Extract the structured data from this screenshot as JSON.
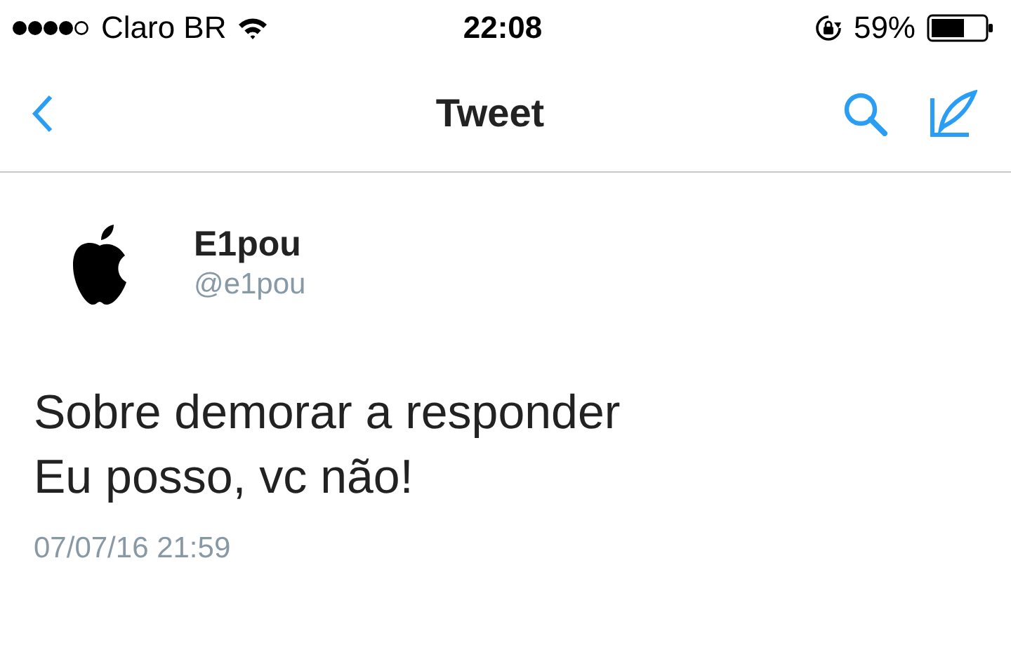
{
  "status_bar": {
    "carrier": "Claro BR",
    "time": "22:08",
    "battery": "59%"
  },
  "nav": {
    "title": "Tweet"
  },
  "tweet": {
    "name": "E1pou",
    "handle": "@e1pou",
    "lines": [
      "Sobre demorar a responder",
      "Eu posso, vc não!"
    ],
    "timestamp": "07/07/16 21:59"
  }
}
